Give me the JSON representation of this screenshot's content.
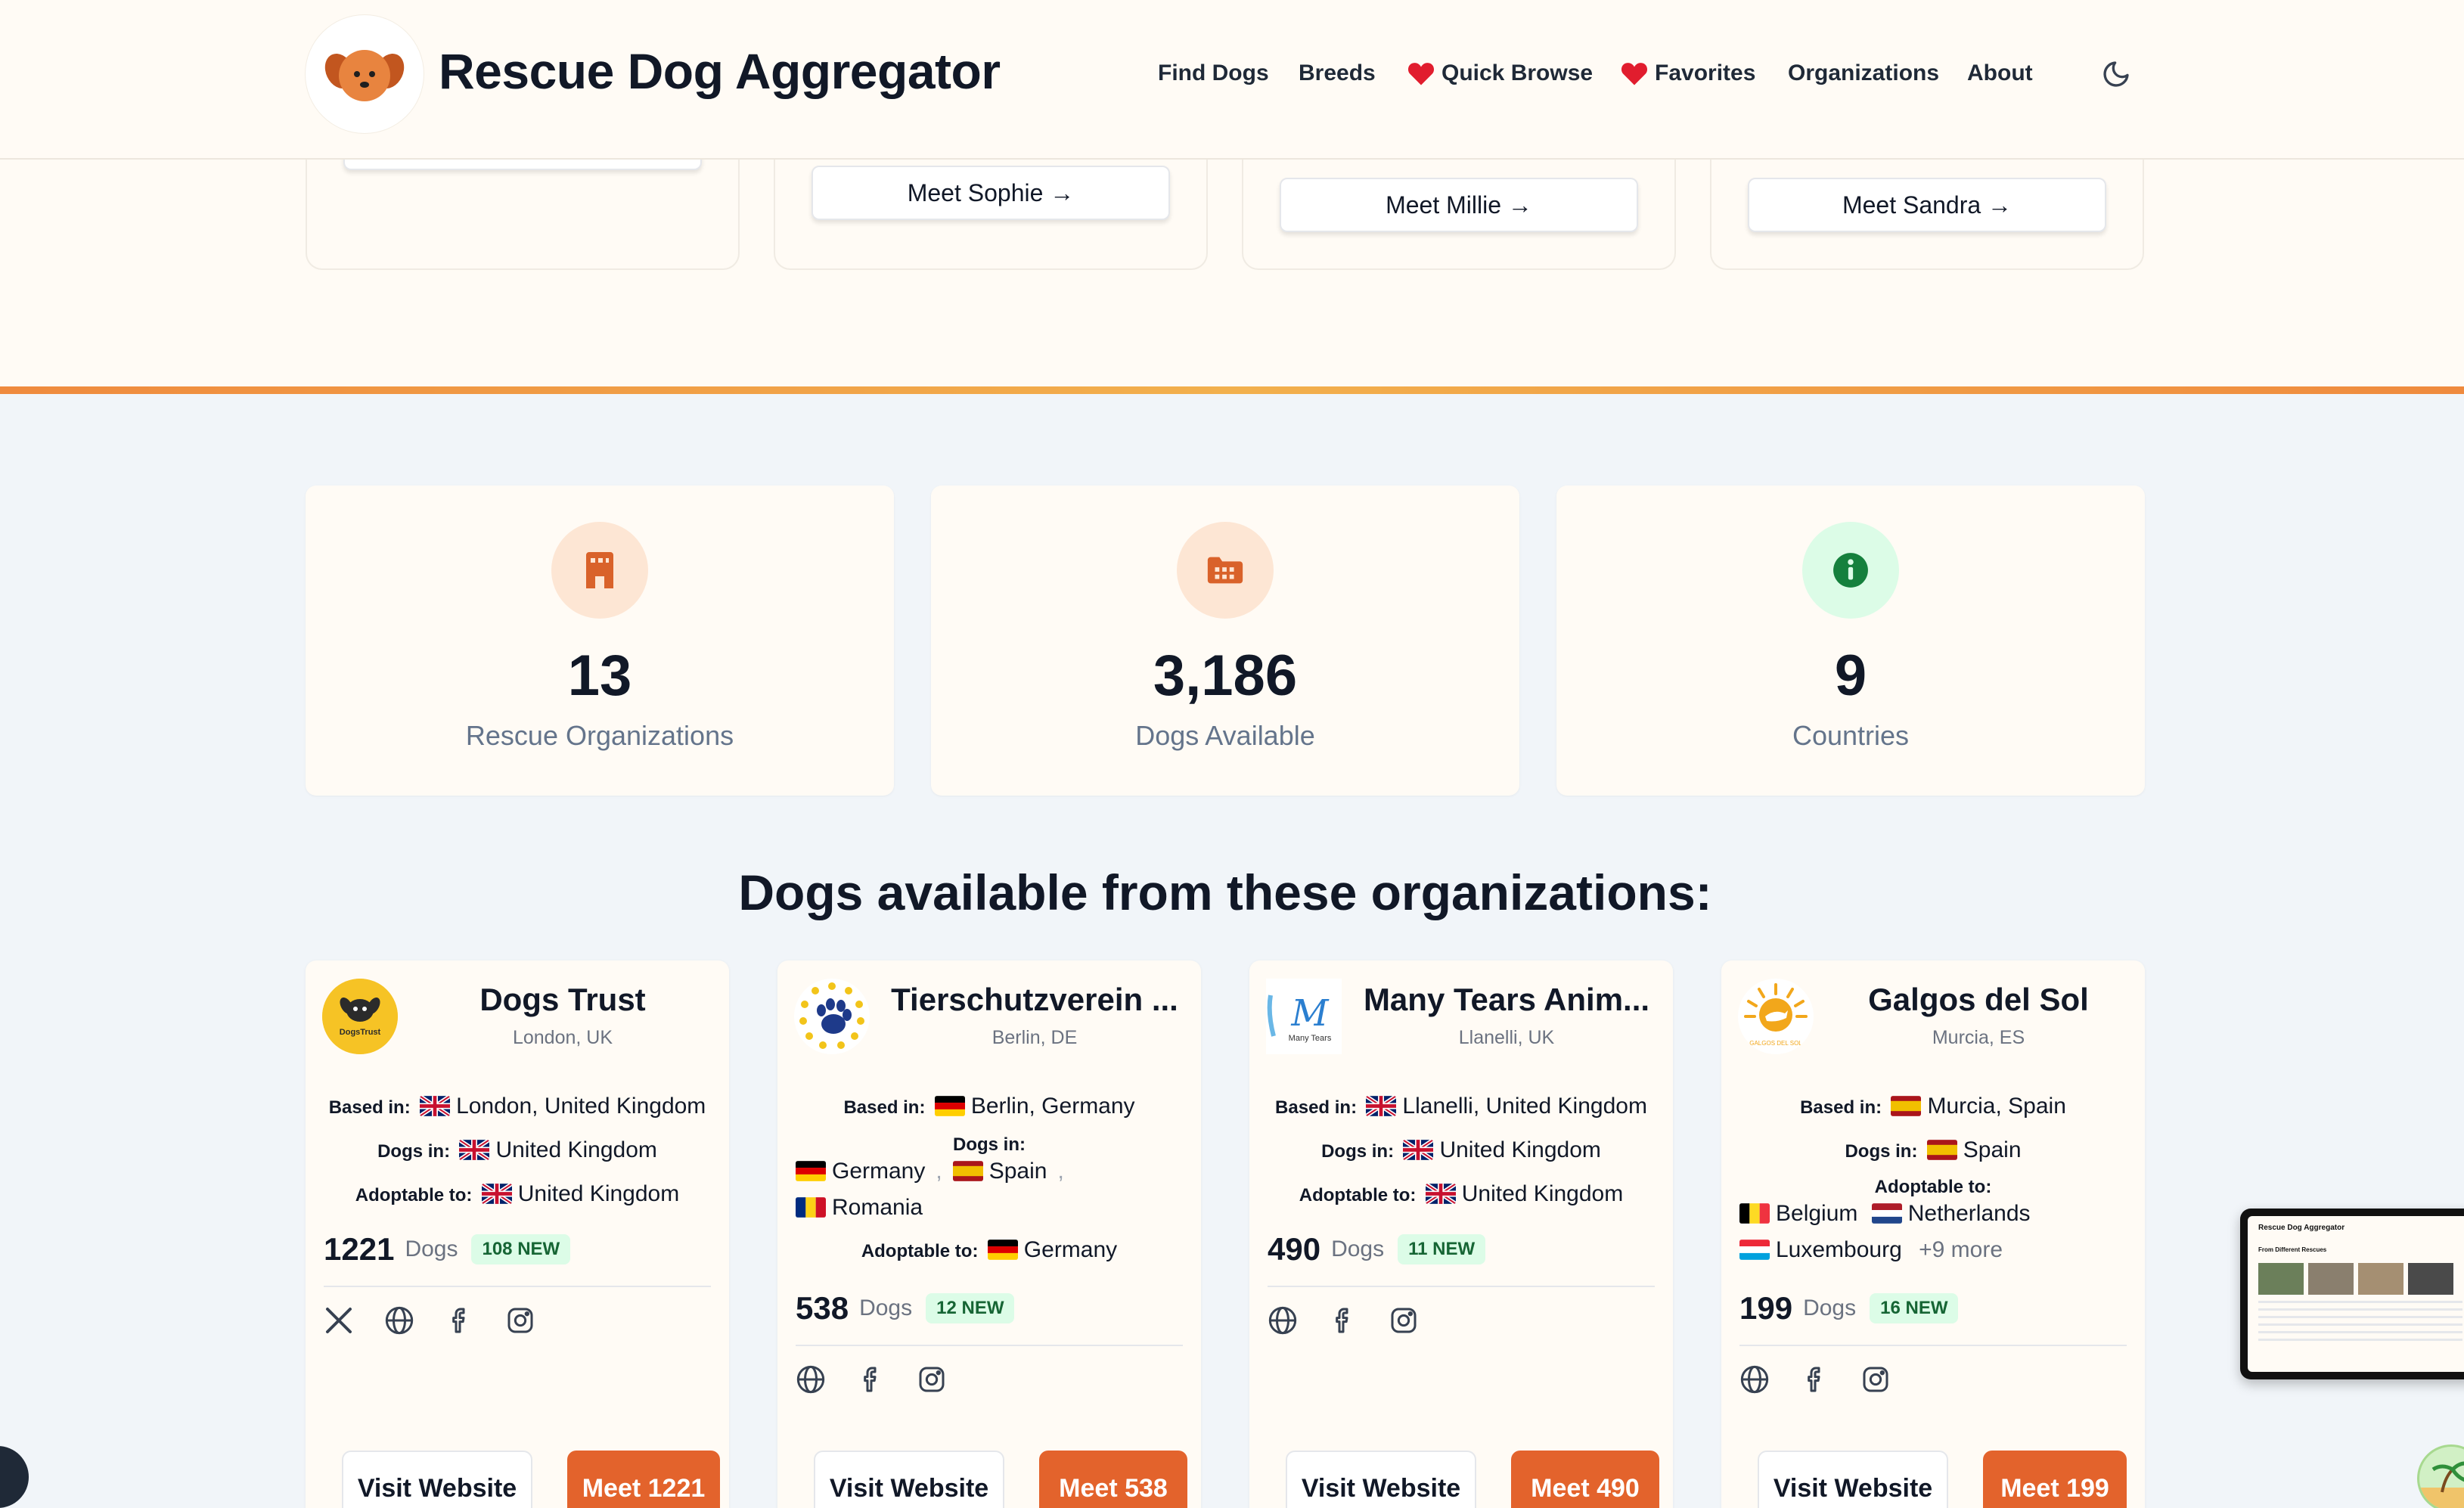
{
  "header": {
    "brand": "Rescue Dog Aggregator",
    "nav": [
      {
        "label": "Find Dogs"
      },
      {
        "label": "Breeds"
      },
      {
        "label": "Quick Browse"
      },
      {
        "label": "Favorites"
      },
      {
        "label": "Organizations"
      },
      {
        "label": "About"
      }
    ]
  },
  "featured_dogs": {
    "buttons": [
      "Meet Sophie →",
      "Meet Millie →",
      "Meet Sandra →"
    ]
  },
  "stats": [
    {
      "value": "13",
      "label": "Rescue Organizations",
      "icon": "building-icon"
    },
    {
      "value": "3,186",
      "label": "Dogs Available",
      "icon": "dogs-grid-icon"
    },
    {
      "value": "9",
      "label": "Countries",
      "icon": "info-icon"
    }
  ],
  "section_title": "Dogs available from these organizations:",
  "orgs": [
    {
      "name": "Dogs Trust",
      "logo_text": "DogsTrust",
      "location": "London, UK",
      "based_label": "Based in:",
      "based_in": "London, United Kingdom",
      "dogs_in_label": "Dogs in:",
      "dogs_in": [
        "United Kingdom"
      ],
      "adoptable_label": "Adoptable to:",
      "adoptable_to": [
        "United Kingdom"
      ],
      "count": "1221",
      "count_label": "Dogs",
      "new_badge": "108 NEW",
      "visit": "Visit Website",
      "meet": "Meet 1221"
    },
    {
      "name": "Tierschutzverein ...",
      "location": "Berlin, DE",
      "based_label": "Based in:",
      "based_in": "Berlin, Germany",
      "dogs_in_label": "Dogs in:",
      "dogs_in": [
        "Germany",
        "Spain",
        "Romania"
      ],
      "adoptable_label": "Adoptable to:",
      "adoptable_to": [
        "Germany"
      ],
      "count": "538",
      "count_label": "Dogs",
      "new_badge": "12 NEW",
      "visit": "Visit Website",
      "meet": "Meet 538"
    },
    {
      "name": "Many Tears Anim...",
      "logo_text": "Many Tears",
      "location": "Llanelli, UK",
      "based_label": "Based in:",
      "based_in": "Llanelli, United Kingdom",
      "dogs_in_label": "Dogs in:",
      "dogs_in": [
        "United Kingdom"
      ],
      "adoptable_label": "Adoptable to:",
      "adoptable_to": [
        "United Kingdom"
      ],
      "count": "490",
      "count_label": "Dogs",
      "new_badge": "11 NEW",
      "visit": "Visit Website",
      "meet": "Meet 490"
    },
    {
      "name": "Galgos del Sol",
      "logo_text": "GALGOS DEL SOL",
      "location": "Murcia, ES",
      "based_label": "Based in:",
      "based_in": "Murcia, Spain",
      "dogs_in_label": "Dogs in:",
      "dogs_in": [
        "Spain"
      ],
      "adoptable_label": "Adoptable to:",
      "adoptable_to": [
        "Belgium",
        "Netherlands",
        "Luxembourg"
      ],
      "more": "+9 more",
      "count": "199",
      "count_label": "Dogs",
      "new_badge": "16 NEW",
      "visit": "Visit Website",
      "meet": "Meet 199"
    }
  ],
  "thumbnail": {
    "title": "Rescue Dog Aggregator",
    "subtitle": "From Different Rescues"
  },
  "colors": {
    "accent": "#e3632c",
    "background": "#f1f5f9",
    "card": "#fffbf5",
    "new_badge_bg": "#dcfce7",
    "new_badge_text": "#166534"
  }
}
